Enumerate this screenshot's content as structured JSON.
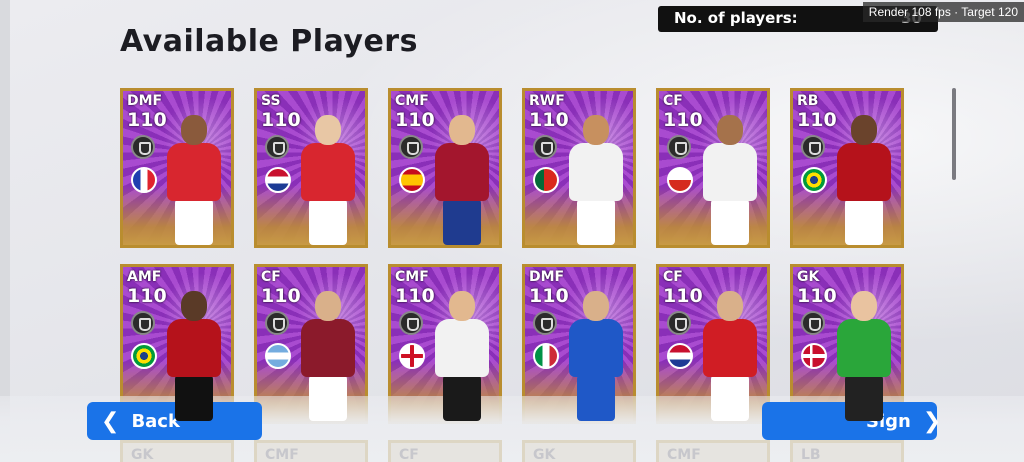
{
  "overlay": {
    "render": "Render 108 fps · Target 120"
  },
  "header": {
    "title": "Available Players",
    "counter_label": "No. of players:",
    "counter_value": "30"
  },
  "cards": [
    {
      "pos": "DMF",
      "rating": "110",
      "flag": "fr",
      "kit": [
        "#d8262f",
        "#fff",
        "#8a5a3c"
      ]
    },
    {
      "pos": "SS",
      "rating": "110",
      "flag": "nl",
      "kit": [
        "#d8262f",
        "#fff",
        "#e8c7a5"
      ]
    },
    {
      "pos": "CMF",
      "rating": "110",
      "flag": "es",
      "kit": [
        "#a3162d",
        "#1f3b8f",
        "#e2b88f"
      ]
    },
    {
      "pos": "RWF",
      "rating": "110",
      "flag": "pt",
      "kit": [
        "#f2f2f2",
        "#fff",
        "#c7905f"
      ]
    },
    {
      "pos": "CF",
      "rating": "110",
      "flag": "cl",
      "kit": [
        "#f2f2f2",
        "#fff",
        "#a5724b"
      ]
    },
    {
      "pos": "RB",
      "rating": "110",
      "flag": "br",
      "kit": [
        "#b5121b",
        "#fff",
        "#6a432c"
      ]
    },
    {
      "pos": "AMF",
      "rating": "110",
      "flag": "br",
      "kit": [
        "#b5121b",
        "#111",
        "#5a3a27"
      ]
    },
    {
      "pos": "CF",
      "rating": "110",
      "flag": "ar",
      "kit": [
        "#8b1a2b",
        "#fff",
        "#d9b08a"
      ]
    },
    {
      "pos": "CMF",
      "rating": "110",
      "flag": "en",
      "kit": [
        "#f2f2f2",
        "#1a1a1a",
        "#e2b88f"
      ]
    },
    {
      "pos": "DMF",
      "rating": "110",
      "flag": "it",
      "kit": [
        "#1f58c7",
        "#1f58c7",
        "#d9b08a"
      ]
    },
    {
      "pos": "CF",
      "rating": "110",
      "flag": "nl",
      "kit": [
        "#d01d24",
        "#fff",
        "#d9b08a"
      ]
    },
    {
      "pos": "GK",
      "rating": "110",
      "flag": "dk",
      "kit": [
        "#2aa63a",
        "#222",
        "#e9c3a0"
      ]
    }
  ],
  "ghost_row": [
    "GK",
    "CMF",
    "CF",
    "GK",
    "CMF",
    "LB"
  ],
  "buttons": {
    "back": {
      "label": "Back",
      "icon": "chevron-left-icon"
    },
    "sign": {
      "label": "Sign",
      "icon": "chevron-right-icon"
    }
  }
}
